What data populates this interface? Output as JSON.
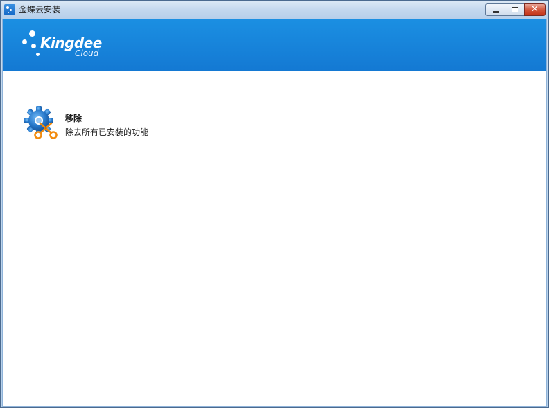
{
  "window": {
    "title": "金蝶云安装",
    "controls": {
      "minimize": "minimize",
      "maximize": "maximize",
      "close": "✕"
    }
  },
  "banner": {
    "logo_word": "Kingdee",
    "logo_sub": "Cloud",
    "color": "#1479d3"
  },
  "options": [
    {
      "title": "移除",
      "description": "除去所有已安装的功能",
      "icon": "gear-scissors-icon"
    }
  ]
}
